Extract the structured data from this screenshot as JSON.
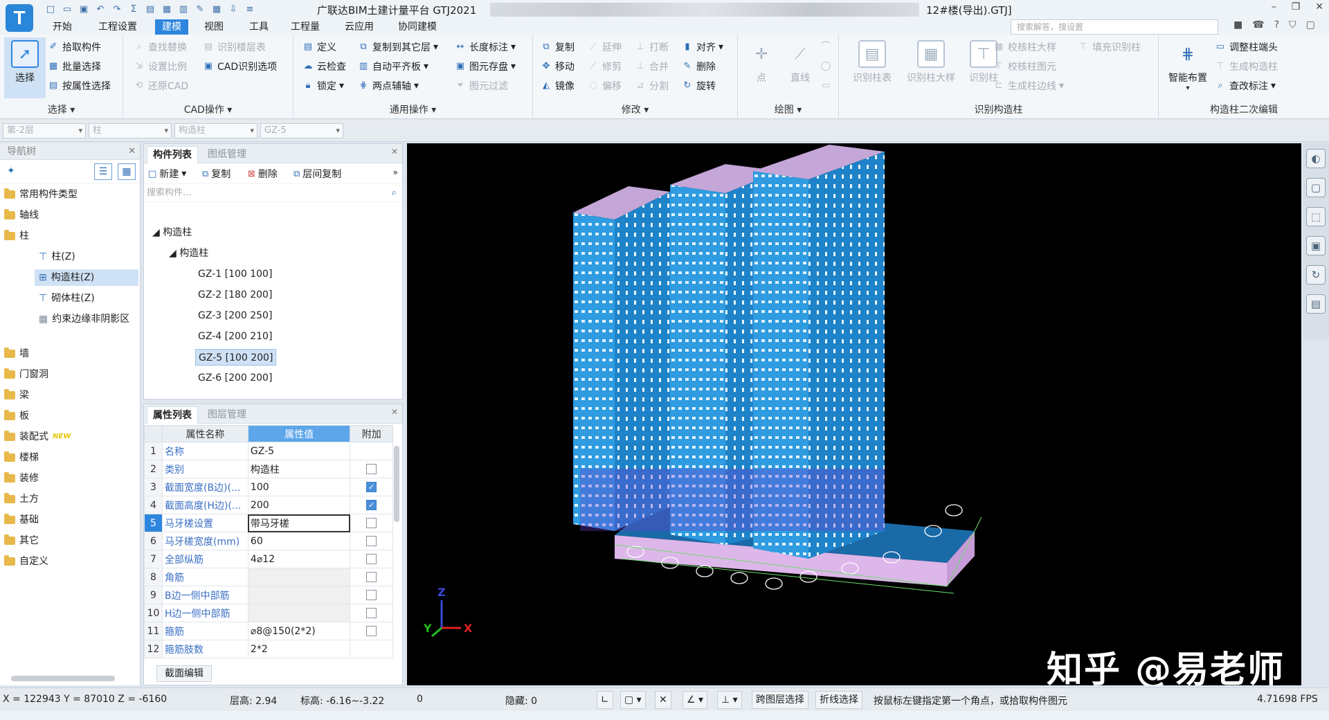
{
  "titlebar": {
    "app_title": "广联达BIM土建计量平台 GTJ2021",
    "file_name": "12#楼(导出).GTJ]",
    "logo_letter": "T"
  },
  "menu": {
    "tabs": [
      "开始",
      "工程设置",
      "建模",
      "视图",
      "工具",
      "工程量",
      "云应用",
      "协同建模"
    ],
    "active": "建模",
    "search_placeholder": "搜索解答，搜设置"
  },
  "ribbon": {
    "select_group": {
      "big": "选择",
      "items": [
        "拾取构件",
        "批量选择",
        "按属性选择"
      ],
      "label": "选择"
    },
    "cad_group": {
      "col1": [
        "查找替换",
        "设置比例",
        "还原CAD"
      ],
      "col2": [
        "识别楼层表",
        "CAD识别选项"
      ],
      "label": "CAD操作"
    },
    "common_group": {
      "col1": [
        "定义",
        "云检查",
        "锁定"
      ],
      "col2": [
        "复制到其它层",
        "自动平齐板",
        "两点辅轴"
      ],
      "col3": [
        "长度标注",
        "图元存盘",
        "图元过滤"
      ],
      "label": "通用操作"
    },
    "modify_group": {
      "col1": [
        "复制",
        "移动",
        "镜像"
      ],
      "col2": [
        "延伸",
        "修剪",
        "偏移"
      ],
      "col3": [
        "打断",
        "合并",
        "分割"
      ],
      "col4": [
        "对齐",
        "删除",
        "旋转"
      ],
      "label": "修改"
    },
    "draw_group": {
      "items": [
        "点",
        "直线"
      ],
      "label": "绘图"
    },
    "recognize_group": {
      "big": [
        "识别柱表",
        "识别柱大样",
        "识别柱"
      ],
      "col": [
        "校核柱大样",
        "校核柱图元",
        "生成柱边线"
      ],
      "extra": "填充识别柱",
      "label": "识别构造柱"
    },
    "edit2_group": {
      "big": "智能布置",
      "col": [
        "调整柱端头",
        "生成构造柱",
        "查改标注"
      ],
      "label": "构造柱二次编辑"
    }
  },
  "combos": [
    "第-2层",
    "柱",
    "构造柱",
    "GZ-5"
  ],
  "navtree": {
    "title": "导航树",
    "items": [
      {
        "label": "常用构件类型",
        "type": "folder"
      },
      {
        "label": "轴线",
        "type": "folder"
      },
      {
        "label": "柱",
        "type": "folder"
      },
      {
        "label": "柱(Z)",
        "type": "child"
      },
      {
        "label": "构造柱(Z)",
        "type": "child",
        "selected": true
      },
      {
        "label": "砌体柱(Z)",
        "type": "child"
      },
      {
        "label": "约束边缘非阴影区",
        "type": "child"
      },
      {
        "label": "墙",
        "type": "folder"
      },
      {
        "label": "门窗洞",
        "type": "folder"
      },
      {
        "label": "梁",
        "type": "folder"
      },
      {
        "label": "板",
        "type": "folder"
      },
      {
        "label": "装配式",
        "type": "folder",
        "tag": "NEW"
      },
      {
        "label": "楼梯",
        "type": "folder"
      },
      {
        "label": "装修",
        "type": "folder"
      },
      {
        "label": "土方",
        "type": "folder"
      },
      {
        "label": "基础",
        "type": "folder"
      },
      {
        "label": "其它",
        "type": "folder"
      },
      {
        "label": "自定义",
        "type": "folder"
      }
    ]
  },
  "component_list": {
    "tabs": [
      "构件列表",
      "图纸管理"
    ],
    "tools": [
      "新建",
      "复制",
      "删除",
      "层间复制"
    ],
    "search_placeholder": "搜索构件...",
    "root": "构造柱",
    "group": "构造柱",
    "items": [
      "GZ-1 [100 100]",
      "GZ-2 [180 200]",
      "GZ-3 [200 250]",
      "GZ-4 [200 210]",
      "GZ-5 [100 200]",
      "GZ-6 [200 200]"
    ],
    "selected": "GZ-5 [100 200]"
  },
  "properties": {
    "tabs": [
      "属性列表",
      "图层管理"
    ],
    "headers": [
      "属性名称",
      "属性值",
      "附加"
    ],
    "rows": [
      {
        "n": "1",
        "name": "名称",
        "value": "GZ-5",
        "chk": null
      },
      {
        "n": "2",
        "name": "类别",
        "value": "构造柱",
        "chk": false
      },
      {
        "n": "3",
        "name": "截面宽度(B边)(...",
        "value": "100",
        "chk": true
      },
      {
        "n": "4",
        "name": "截面高度(H边)(...",
        "value": "200",
        "chk": true
      },
      {
        "n": "5",
        "name": "马牙槎设置",
        "value": "带马牙槎",
        "chk": false,
        "selected": true
      },
      {
        "n": "6",
        "name": "马牙槎宽度(mm)",
        "value": "60",
        "chk": false
      },
      {
        "n": "7",
        "name": "全部纵筋",
        "value": "4⌀12",
        "chk": false
      },
      {
        "n": "8",
        "name": "角筋",
        "value": "",
        "chk": false
      },
      {
        "n": "9",
        "name": "B边一侧中部筋",
        "value": "",
        "chk": false
      },
      {
        "n": "10",
        "name": "H边一侧中部筋",
        "value": "",
        "chk": false
      },
      {
        "n": "11",
        "name": "箍筋",
        "value": "⌀8@150(2*2)",
        "chk": false
      },
      {
        "n": "12",
        "name": "箍筋肢数",
        "value": "2*2",
        "chk": null
      }
    ],
    "edit_button": "截面编辑"
  },
  "viewport": {
    "watermark": "知乎 @易老师",
    "axis": {
      "x": "X",
      "y": "Y",
      "z": "Z"
    }
  },
  "statusbar": {
    "coords": "X = 122943 Y = 87010 Z = -6160",
    "floor_height": "层高:  2.94",
    "elevation": "标高:  -6.16~-3.22",
    "count": "0",
    "hidden": "隐藏:  0",
    "btn_cross": "跨图层选择",
    "btn_poly": "折线选择",
    "hint": "按鼠标左键指定第一个角点，或拾取构件图元",
    "fps": "4.71698 FPS"
  },
  "colors": {
    "accent": "#2e86de",
    "building": "#2f9be0",
    "viewport_bg": "#000000"
  }
}
